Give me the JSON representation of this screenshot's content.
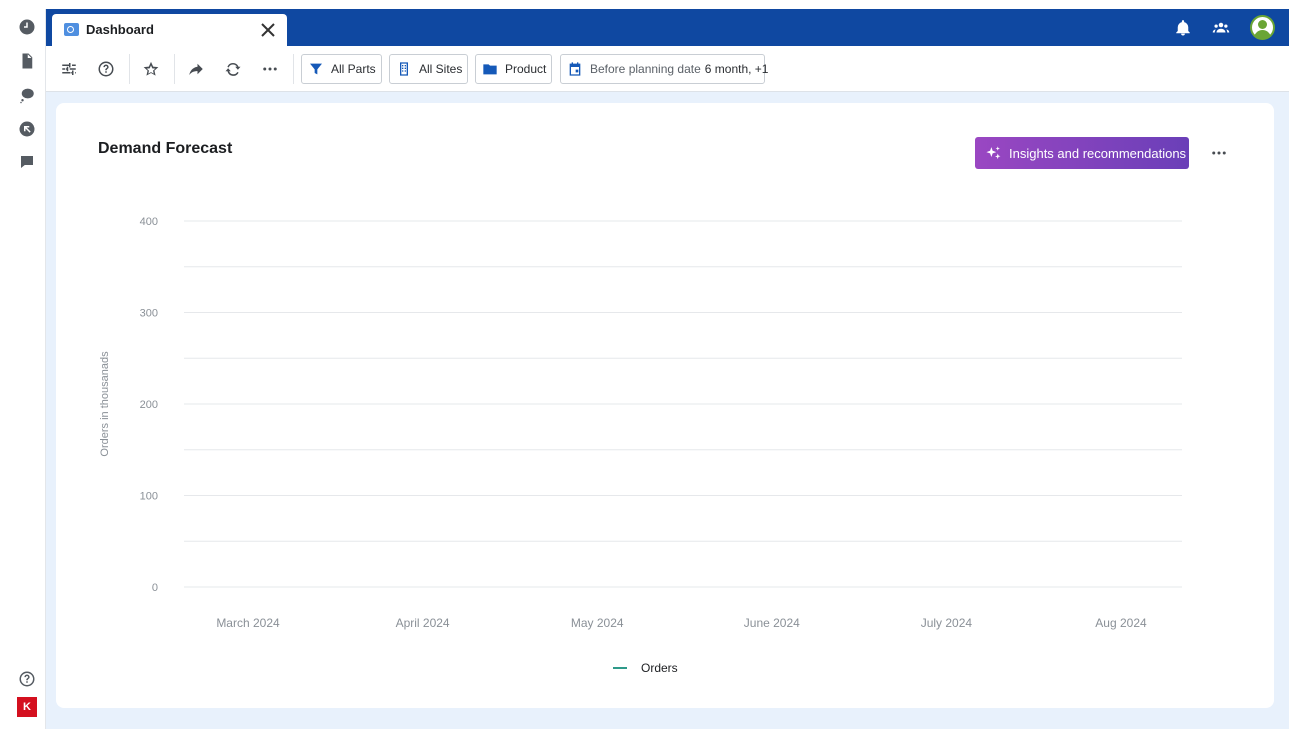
{
  "window": {
    "tab_title": "Dashboard",
    "tab_close_icon": "close-icon"
  },
  "left_rail": {
    "items": [
      {
        "icon": "clock-icon"
      },
      {
        "icon": "document-icon"
      },
      {
        "icon": "chat-bubble-icon"
      },
      {
        "icon": "arrow-circle-icon"
      },
      {
        "icon": "comment-icon"
      }
    ],
    "help_icon": "help-icon",
    "logo_text": "K",
    "logo_color": "#d4101f"
  },
  "topbar": {
    "color": "#0f48a1",
    "icons": [
      "bell-icon",
      "people-icon",
      "avatar"
    ]
  },
  "toolbar": {
    "icons": [
      "filter-sliders-icon",
      "help-icon",
      "star-icon",
      "share-icon",
      "refresh-icon",
      "more-icon"
    ],
    "chips": {
      "parts": "All Parts",
      "sites": "All Sites",
      "product": "Product",
      "date_label": "Before planning date",
      "date_value": "6 month, +1"
    }
  },
  "card": {
    "title": "Demand Forecast",
    "insights_label": "Insights and recommendations",
    "insights_gradient": [
      "#9a47c2",
      "#6a3fb8"
    ],
    "more_icon": "more-icon"
  },
  "chart_data": {
    "type": "line",
    "title": "Demand Forecast",
    "xlabel": "",
    "ylabel": "Orders in thousanads",
    "categories": [
      "March 2024",
      "April 2024",
      "May 2024",
      "June 2024",
      "July 2024",
      "Aug 2024"
    ],
    "y_ticks": [
      "0",
      "100",
      "200",
      "300",
      "400"
    ],
    "ylim": [
      0,
      400
    ],
    "series": [
      {
        "name": "Orders",
        "color": "#2f9a8a",
        "values": []
      }
    ],
    "grid": true,
    "legend_position": "bottom-center"
  }
}
